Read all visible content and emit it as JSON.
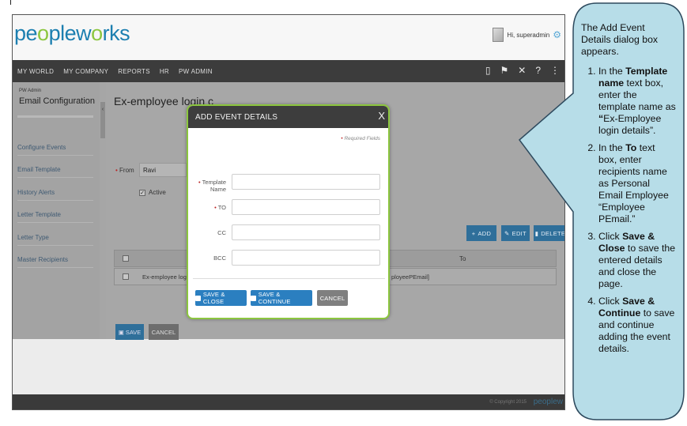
{
  "app": {
    "logo_text_prefix": "pe",
    "logo_o1": "o",
    "logo_text_mid": "plew",
    "logo_o2": "o",
    "logo_text_suffix": "rks",
    "greeting": "Hi, superadmin"
  },
  "nav": {
    "items": [
      "MY WORLD",
      "MY COMPANY",
      "REPORTS",
      "HR",
      "PW ADMIN"
    ],
    "icons": [
      "book-icon",
      "flag-icon",
      "tools-icon",
      "help-icon",
      "share-icon"
    ]
  },
  "sidebar": {
    "subtitle": "PW Admin",
    "title": "Email Configuration",
    "items": [
      "Configure Events",
      "Email Template",
      "History Alerts",
      "Letter Template",
      "Letter Type",
      "Master Recipients"
    ]
  },
  "main": {
    "title": "Ex-employee login c",
    "from_label": "From",
    "from_value": "Ravi",
    "active_label": "Active",
    "buttons": {
      "add": "ADD",
      "edit": "EDIT",
      "delete": "DELETE"
    },
    "table": {
      "header_to": "To",
      "row_name": "Ex-employee login c",
      "row_to": "ployeePEmail]"
    },
    "save": "SAVE",
    "cancel": "CANCEL"
  },
  "footer": {
    "copyright": "© Copyright 2015",
    "logo": "peoplew"
  },
  "modal": {
    "title": "ADD EVENT DETAILS",
    "close": "X",
    "required_note": "Required Fields",
    "fields": {
      "template_name_line1": "Template",
      "template_name_line2": "Name",
      "to": "TO",
      "cc": "CC",
      "bcc": "BCC"
    },
    "buttons": {
      "save_close": "SAVE & CLOSE",
      "save_continue": "SAVE & CONTINUE",
      "cancel": "CANCEL"
    }
  },
  "callout": {
    "intro": "The Add Event Details dialog box appears.",
    "step1_a": "In the ",
    "step1_b": "Template name",
    "step1_c": " text box, enter the template name as ",
    "step1_d": "“",
    "step1_e": "Ex-Employee login details”.",
    "step2_a": "In the ",
    "step2_b": "To",
    "step2_c": " text box, enter recipients name as Personal Email Employee “Employee PEmail.”",
    "step3_a": "Click ",
    "step3_b": "Save & Close",
    "step3_c": " to save the entered details and close the page.",
    "step4_a": "Click ",
    "step4_b": "Save & Continue",
    "step4_c": " to save and continue adding the event details."
  },
  "colors": {
    "brand_blue": "#1c7fb0",
    "brand_green": "#8cc63f",
    "button_blue": "#2b7fc0",
    "callout_fill": "#b7dde8",
    "callout_stroke": "#2e4a5e"
  }
}
